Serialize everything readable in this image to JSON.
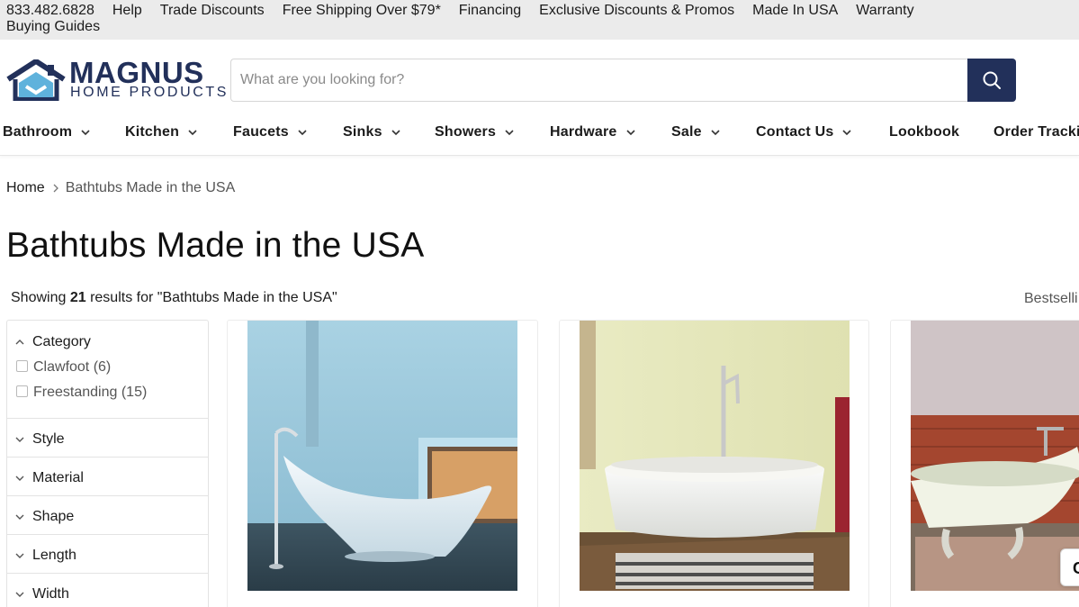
{
  "utility_bar": {
    "links": [
      "833.482.6828",
      "Help",
      "Trade Discounts",
      "Free Shipping Over $79*",
      "Financing",
      "Exclusive Discounts & Promos",
      "Made In USA",
      "Warranty"
    ],
    "second_row_link": "Buying Guides"
  },
  "header": {
    "logo": {
      "line1": "MAGNUS",
      "line2": "HOME PRODUCTS"
    },
    "search": {
      "placeholder": "What are you looking for?",
      "value": ""
    }
  },
  "nav": {
    "items": [
      {
        "label": "Bathroom",
        "has_dropdown": true
      },
      {
        "label": "Kitchen",
        "has_dropdown": true
      },
      {
        "label": "Faucets",
        "has_dropdown": true
      },
      {
        "label": "Sinks",
        "has_dropdown": true
      },
      {
        "label": "Showers",
        "has_dropdown": true
      },
      {
        "label": "Hardware",
        "has_dropdown": true
      },
      {
        "label": "Sale",
        "has_dropdown": true
      },
      {
        "label": "Contact Us",
        "has_dropdown": true
      },
      {
        "label": "Lookbook",
        "has_dropdown": false
      },
      {
        "label": "Order Tracki",
        "has_dropdown": false
      }
    ]
  },
  "breadcrumb": {
    "home": "Home",
    "current": "Bathtubs Made in the USA"
  },
  "page": {
    "title": "Bathtubs Made in the USA",
    "results_prefix": "Showing ",
    "results_count": "21",
    "results_suffix": " results for \"Bathtubs Made in the USA\"",
    "sort_label": "Bestselli"
  },
  "filters": {
    "category": {
      "label": "Category",
      "expanded": true,
      "options": [
        {
          "label": "Clawfoot (6)",
          "checked": false
        },
        {
          "label": "Freestanding (15)",
          "checked": false
        }
      ]
    },
    "collapsed": [
      "Style",
      "Material",
      "Shape",
      "Length",
      "Width"
    ]
  },
  "products": [
    {
      "image": "white-vessel-bathtub-blue-room"
    },
    {
      "image": "white-oval-freestanding-tub-yellow-room"
    },
    {
      "image": "white-clawfoot-slipper-tub"
    }
  ],
  "chat_button_label": "C",
  "colors": {
    "brand_navy": "#22305a",
    "utility_bar_bg": "#ebebeb",
    "border": "#e3e3e3"
  }
}
